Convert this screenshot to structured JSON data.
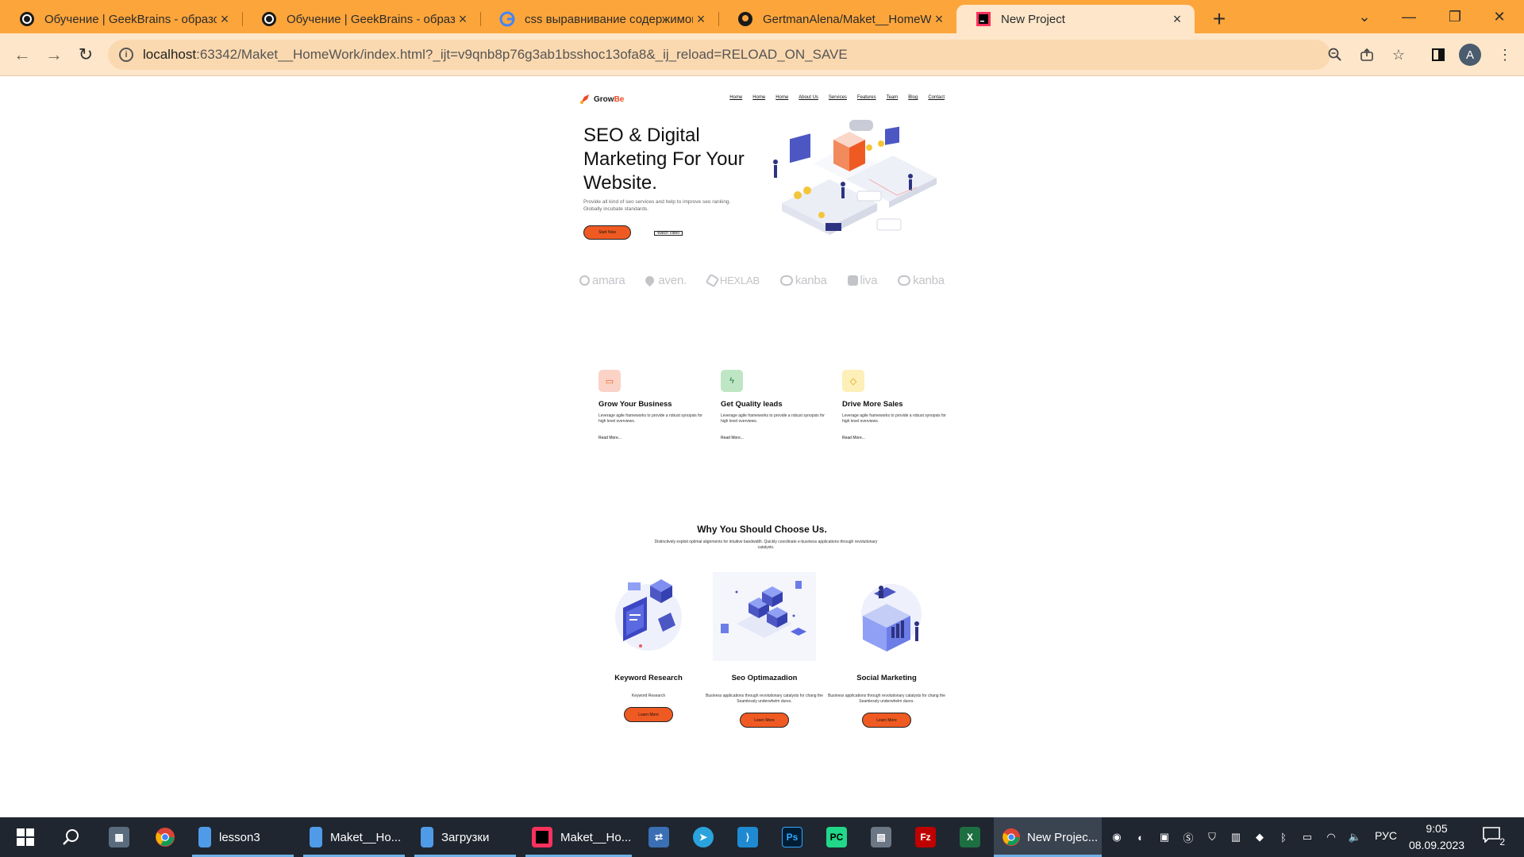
{
  "browser": {
    "tabs": [
      {
        "title": "Обучение | GeekBrains - образо",
        "icon": "geekbrains-icon",
        "active": false
      },
      {
        "title": "Обучение | GeekBrains - образо",
        "icon": "geekbrains-icon",
        "active": false
      },
      {
        "title": "css выравнивание содержимог",
        "icon": "google-icon",
        "active": false
      },
      {
        "title": "GertmanAlena/Maket__HomeWo",
        "icon": "github-icon",
        "active": false
      },
      {
        "title": "New Project",
        "icon": "intellij-icon",
        "active": true
      }
    ],
    "tab_close_glyph": "×",
    "new_tab_glyph": "+",
    "url_host": "localhost",
    "url_rest": ":63342/Maket__HomeWork/index.html?_ijt=v9qnb8p76g3ab1bsshoc13ofa8&_ij_reload=RELOAD_ON_SAVE",
    "profile_initial": "A",
    "accent": "#fca53b"
  },
  "site": {
    "logo_prefix": "Grow",
    "logo_suffix": "Be",
    "nav": [
      "Home",
      "Home",
      "Home",
      "About Us",
      "Services",
      "Features",
      "Team",
      "Blog",
      "Contact"
    ],
    "hero": {
      "title": "SEO & Digital Marketing For Your Website.",
      "subtitle": "Provide all kind of seo services and help to improve seo ranking. Globally incubate standards.",
      "start_button": "Start Now",
      "watch_button": "Watch Video"
    },
    "brands": [
      "amara",
      "aven.",
      "HEXLAB",
      "kanba",
      "liva",
      "kanba"
    ],
    "features": [
      {
        "title": "Grow Your Business",
        "text": "Leverage agile frameworks to provide a robust synopsis for high level overviews.",
        "more": "Read More...",
        "color": "#fbd3c6"
      },
      {
        "title": "Get Quality leads",
        "text": "Leverage agile frameworks to provide a robust synopsis for high level overviews.",
        "more": "Read More...",
        "color": "#bfe6c4"
      },
      {
        "title": "Drive More Sales",
        "text": "Leverage agile frameworks to provide a robust synopsis for high level overviews.",
        "more": "Read More...",
        "color": "#fcefb8"
      }
    ],
    "why": {
      "title": "Why You Should Choose Us.",
      "subtitle": "Distinctively exploit optimal alignments for intuitive bandwidth. Quickly coordinate e-business applications through revolutionary catalysts."
    },
    "cards": [
      {
        "title": "Keyword Research",
        "text": "Keyword Research",
        "button": "Learn More"
      },
      {
        "title": "Seo Optimazadion",
        "text": "Business applications through revolutionary catalysts for chang the Seamlessly underwhelm dures.",
        "button": "Learn More"
      },
      {
        "title": "Social Marketing",
        "text": "Business applications through revolutionary catalysts for chang the Seamlessly underwhelm dures.",
        "button": "Learn More"
      }
    ],
    "accent": "#ef5a22"
  },
  "taskbar": {
    "apps": [
      {
        "label": "lesson3",
        "icon": "folder-icon"
      },
      {
        "label": "Maket__Ho...",
        "icon": "folder-icon"
      },
      {
        "label": "Загрузки",
        "icon": "folder-icon"
      },
      {
        "label": "Maket__Ho...",
        "icon": "intellij-icon"
      },
      {
        "label": "New Projec...",
        "icon": "chrome-icon"
      }
    ],
    "language": "РУС",
    "time": "9:05",
    "date": "08.09.2023",
    "notifications": "2"
  }
}
